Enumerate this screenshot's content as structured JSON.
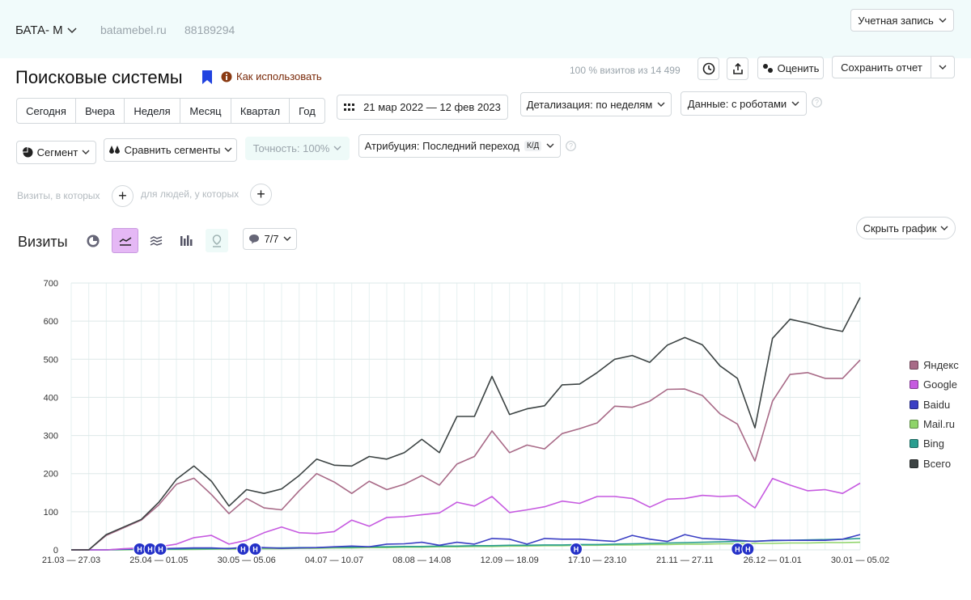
{
  "header": {
    "counter_name": "БАТА- М",
    "site": "batamebel.ru",
    "counter_id": "88189294",
    "account_label": "Учетная запись"
  },
  "report": {
    "title": "Поисковые системы",
    "how_to_use": "Как использовать",
    "visits_info": "100 % визитов из 14 499",
    "rate_label": "Оценить",
    "save_label": "Сохранить отчет"
  },
  "period_tabs": [
    "Сегодня",
    "Вчера",
    "Неделя",
    "Месяц",
    "Квартал",
    "Год"
  ],
  "date_range": "21 мар 2022 — 12 фев 2023",
  "detail_label": "Детализация: по неделям",
  "data_label": "Данные: с роботами",
  "filters": {
    "segment_label": "Сегмент",
    "compare_label": "Сравнить сегменты",
    "accuracy_label": "Точность: 100%",
    "attribution_label": "Атрибуция: Последний переход",
    "attribution_badge": "К/Д"
  },
  "conditions": {
    "visits_where": "Визиты, в которых",
    "people_where": "для людей, у которых"
  },
  "chart_header": {
    "metric_label": "Визиты",
    "notes_count": "7/7",
    "hide_chart_label": "Скрыть график"
  },
  "colors": {
    "yandex": "#a86a87",
    "google": "#c65ae0",
    "baidu": "#3b3fc4",
    "mailru": "#8fd46a",
    "bing": "#2a9d8f",
    "total": "#3c4343",
    "active_chart_type": "#e5b8f5"
  },
  "chart_data": {
    "type": "line",
    "x_tick_labels": [
      "21.03 — 27.03",
      "25.04 — 01.05",
      "30.05 — 05.06",
      "04.07 — 10.07",
      "08.08 — 14.08",
      "12.09 — 18.09",
      "17.10 — 23.10",
      "21.11 — 27.11",
      "26.12 — 01.01",
      "30.01 — 05.02"
    ],
    "ylim": [
      0,
      700
    ],
    "y_ticks": [
      0,
      100,
      200,
      300,
      400,
      500,
      600,
      700
    ],
    "grid": true,
    "legend_position": "right",
    "series": [
      {
        "name": "Яндекс",
        "color_key": "yandex",
        "values": [
          0,
          0,
          38,
          58,
          78,
          118,
          172,
          188,
          145,
          95,
          135,
          110,
          105,
          155,
          200,
          178,
          148,
          180,
          158,
          172,
          195,
          170,
          225,
          245,
          312,
          255,
          275,
          265,
          305,
          318,
          333,
          377,
          374,
          390,
          421,
          422,
          405,
          357,
          330,
          233,
          390,
          460,
          465,
          450,
          450,
          498
        ]
      },
      {
        "name": "Google",
        "color_key": "google",
        "values": [
          0,
          0,
          0,
          3,
          5,
          8,
          15,
          32,
          38,
          15,
          25,
          45,
          60,
          45,
          43,
          48,
          78,
          62,
          85,
          87,
          92,
          97,
          125,
          115,
          140,
          98,
          105,
          113,
          128,
          122,
          140,
          140,
          135,
          112,
          133,
          135,
          143,
          140,
          142,
          110,
          187,
          170,
          155,
          158,
          148,
          175
        ]
      },
      {
        "name": "Baidu",
        "color_key": "baidu",
        "values": [
          0,
          0,
          0,
          2,
          3,
          3,
          4,
          5,
          5,
          3,
          8,
          6,
          4,
          5,
          6,
          8,
          10,
          8,
          15,
          16,
          20,
          12,
          20,
          15,
          30,
          28,
          15,
          30,
          28,
          28,
          25,
          22,
          38,
          28,
          22,
          40,
          30,
          28,
          25,
          22,
          25,
          25,
          25,
          25,
          28,
          40
        ]
      },
      {
        "name": "Mail.ru",
        "color_key": "mailru",
        "values": [
          0,
          0,
          0,
          0,
          1,
          1,
          1,
          1,
          2,
          2,
          2,
          3,
          3,
          4,
          4,
          5,
          5,
          6,
          6,
          7,
          7,
          8,
          8,
          9,
          9,
          10,
          10,
          11,
          11,
          12,
          12,
          13,
          13,
          14,
          14,
          15,
          15,
          16,
          16,
          17,
          17,
          18,
          18,
          19,
          19,
          20
        ]
      },
      {
        "name": "Bing",
        "color_key": "bing",
        "values": [
          0,
          0,
          0,
          1,
          1,
          2,
          2,
          3,
          3,
          4,
          4,
          5,
          5,
          6,
          6,
          7,
          7,
          8,
          8,
          9,
          9,
          10,
          10,
          11,
          11,
          12,
          12,
          13,
          13,
          14,
          14,
          15,
          16,
          17,
          18,
          19,
          20,
          21,
          22,
          23,
          24,
          25,
          26,
          27,
          28,
          30
        ]
      },
      {
        "name": "Всего",
        "color_key": "total",
        "values": [
          0,
          0,
          40,
          60,
          80,
          125,
          185,
          220,
          180,
          115,
          158,
          148,
          160,
          195,
          238,
          222,
          220,
          245,
          238,
          255,
          290,
          255,
          350,
          350,
          455,
          355,
          370,
          378,
          433,
          435,
          465,
          500,
          510,
          492,
          537,
          557,
          538,
          483,
          450,
          320,
          555,
          605,
          595,
          582,
          573,
          662
        ]
      }
    ],
    "annotation_markers": [
      {
        "label": "Н",
        "week_index": 3.9
      },
      {
        "label": "Н",
        "week_index": 4.5
      },
      {
        "label": "Н",
        "week_index": 5.1
      },
      {
        "label": "Н",
        "week_index": 9.8
      },
      {
        "label": "Н",
        "week_index": 10.5
      },
      {
        "label": "Н",
        "week_index": 28.8
      },
      {
        "label": "Н",
        "week_index": 38.0
      },
      {
        "label": "Н",
        "week_index": 38.6
      }
    ]
  }
}
